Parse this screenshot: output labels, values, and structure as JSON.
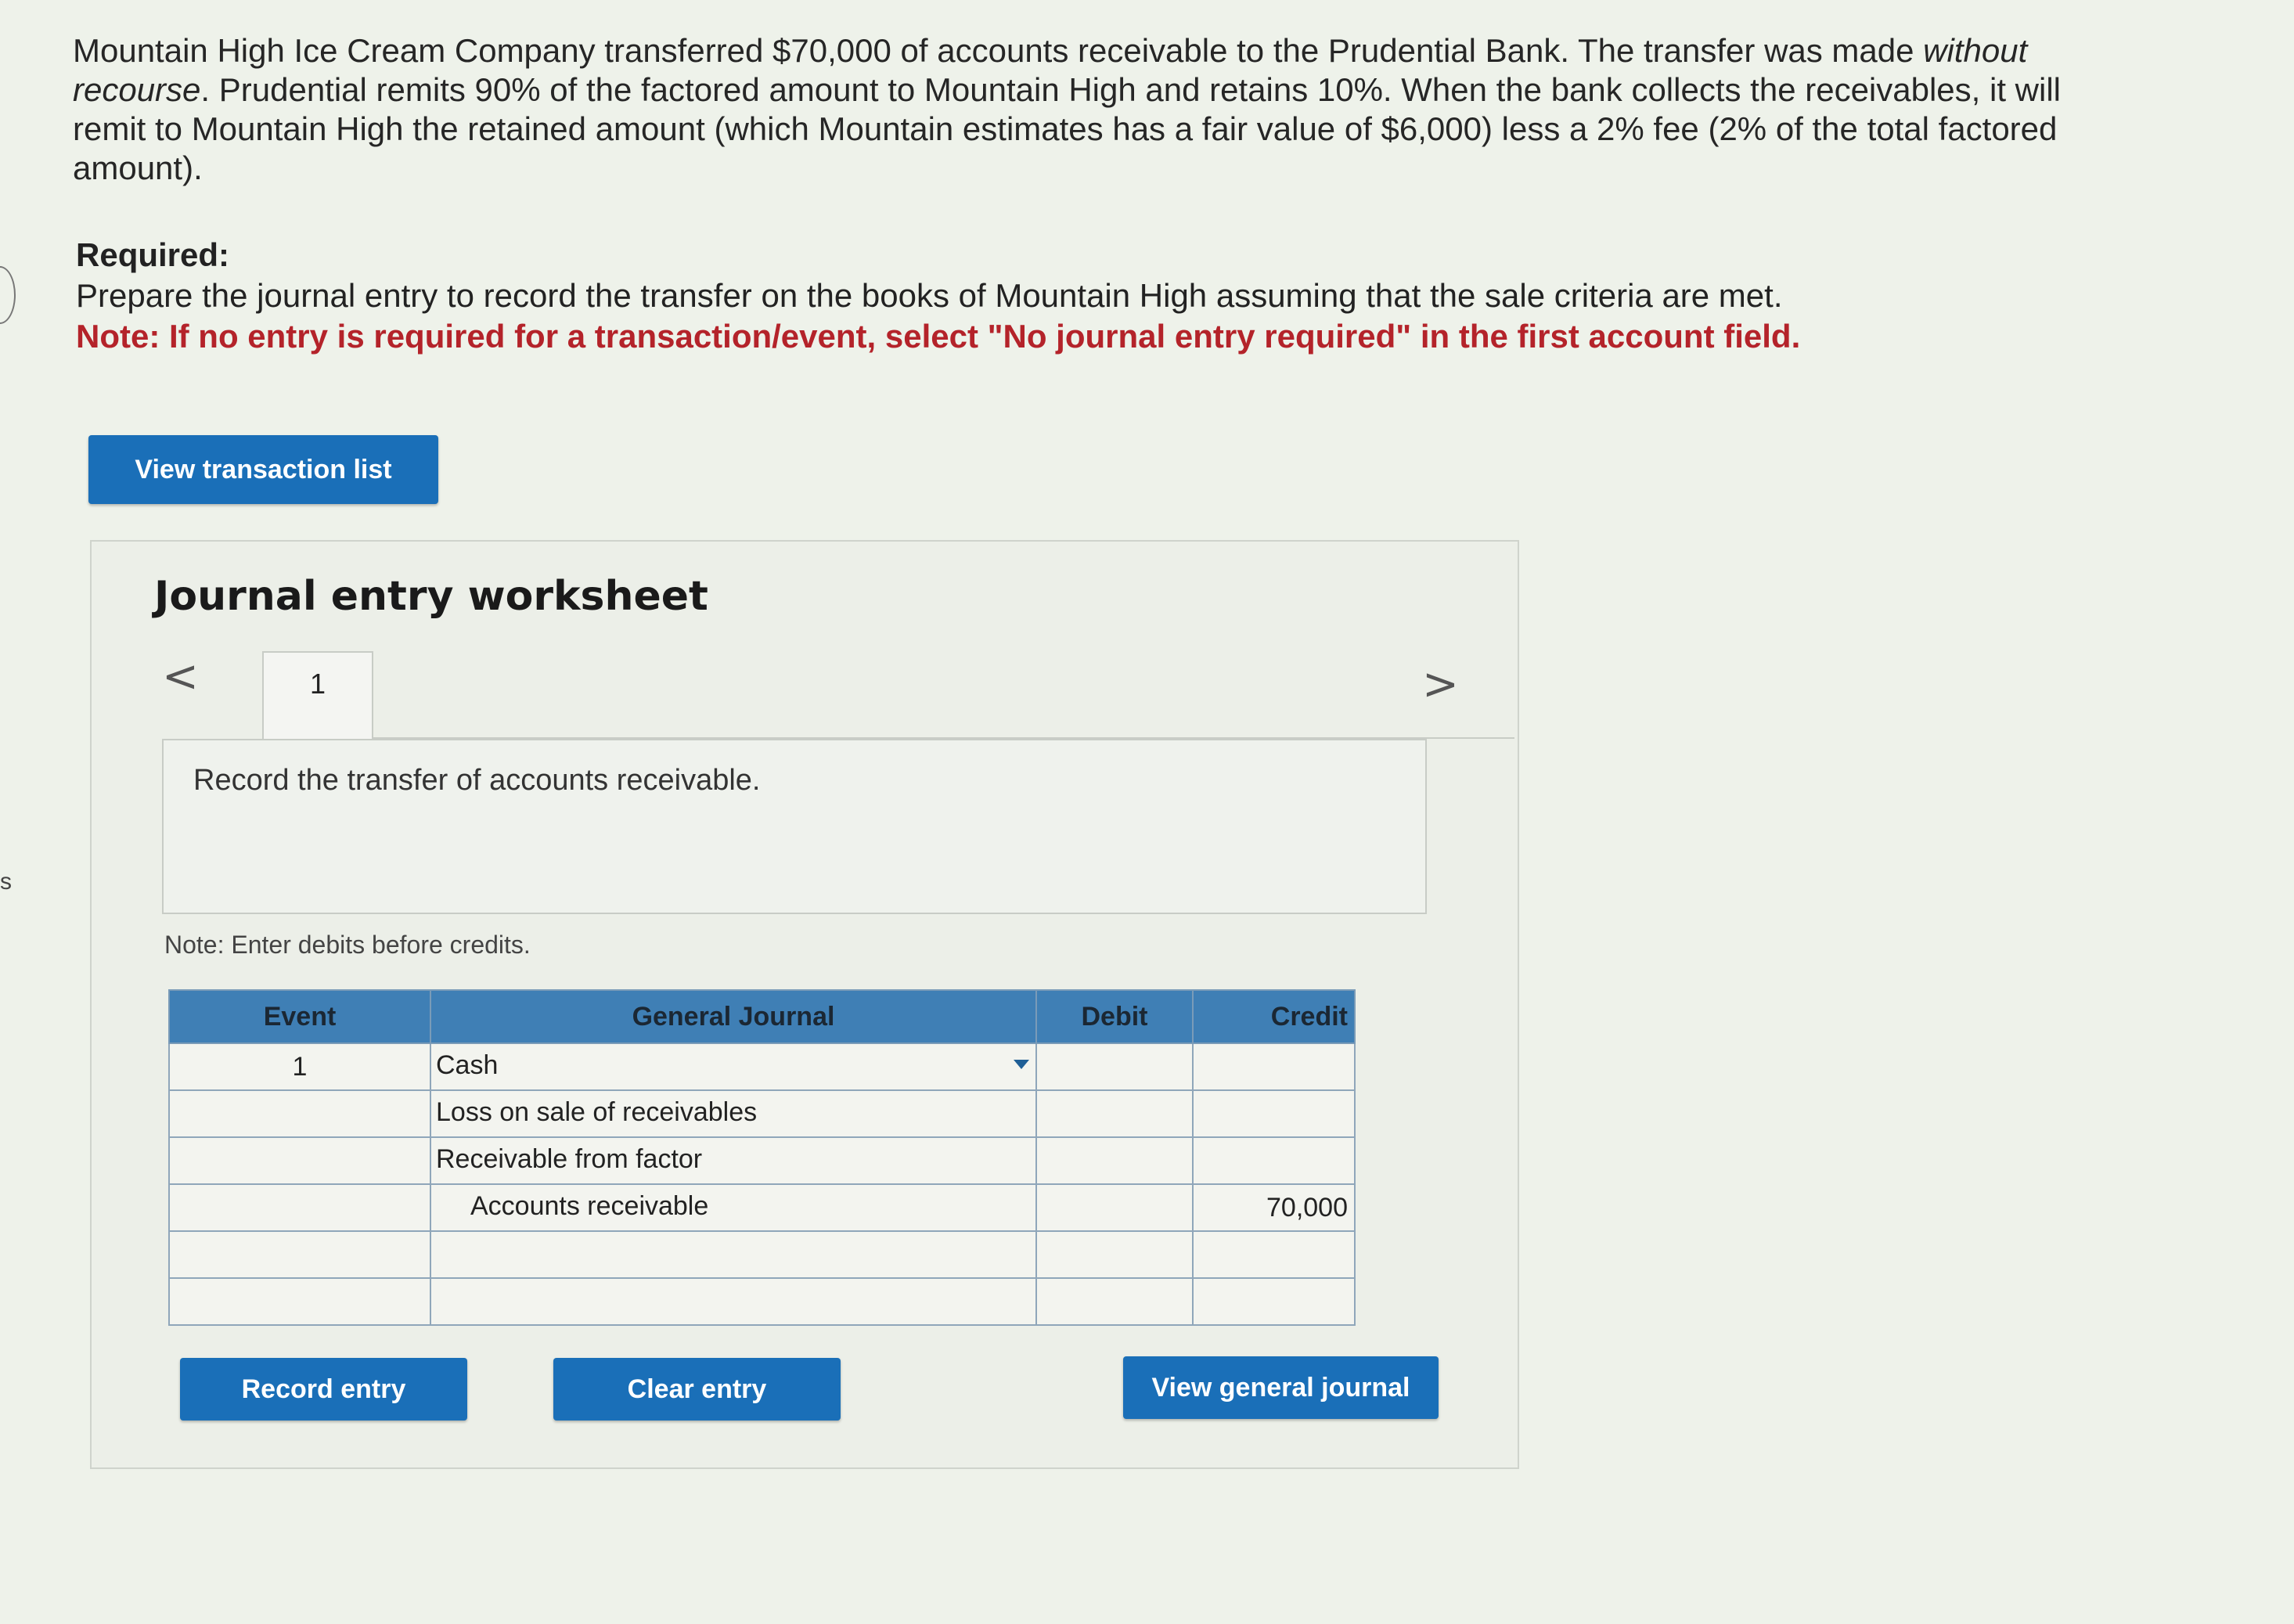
{
  "problem": {
    "part1": "Mountain High Ice Cream Company transferred $70,000 of accounts receivable to the Prudential Bank. The transfer was made ",
    "italic1": "without recourse",
    "part2": ". Prudential remits 90% of the factored amount to Mountain High and retains 10%. When the bank collects the receivables, it will remit to Mountain High the retained amount (which Mountain estimates has a fair value of $6,000) less a 2% fee (2% of the total factored amount)."
  },
  "required": {
    "heading": "Required:",
    "instruction": "Prepare the journal entry to record the transfer on the books of Mountain High assuming that the sale criteria are met.",
    "note": "Note: If no entry is required for a transaction/event, select \"No journal entry required\" in the first account field."
  },
  "buttons": {
    "view_transaction_list": "View transaction list",
    "record_entry": "Record entry",
    "clear_entry": "Clear entry",
    "view_general_journal": "View general journal"
  },
  "worksheet": {
    "title": "Journal entry worksheet",
    "prev_icon": "<",
    "next_icon": ">",
    "tab_label": "1",
    "description": "Record the transfer of accounts receivable.",
    "enter_note": "Note: Enter debits before credits."
  },
  "journal": {
    "headers": {
      "event": "Event",
      "account": "General Journal",
      "debit": "Debit",
      "credit": "Credit"
    },
    "rows": [
      {
        "event": "1",
        "account": "Cash",
        "debit": "",
        "credit": ""
      },
      {
        "event": "",
        "account": "Loss on sale of receivables",
        "debit": "",
        "credit": ""
      },
      {
        "event": "",
        "account": "Receivable from factor",
        "debit": "",
        "credit": ""
      },
      {
        "event": "",
        "account": "Accounts receivable",
        "debit": "",
        "credit": "70,000"
      },
      {
        "event": "",
        "account": "",
        "debit": "",
        "credit": ""
      },
      {
        "event": "",
        "account": "",
        "debit": "",
        "credit": ""
      }
    ]
  },
  "edge": {
    "mark": "s"
  },
  "colors": {
    "button_blue": "#1a6fb8",
    "note_red": "#b4232a",
    "table_header": "#3f7fb5"
  }
}
